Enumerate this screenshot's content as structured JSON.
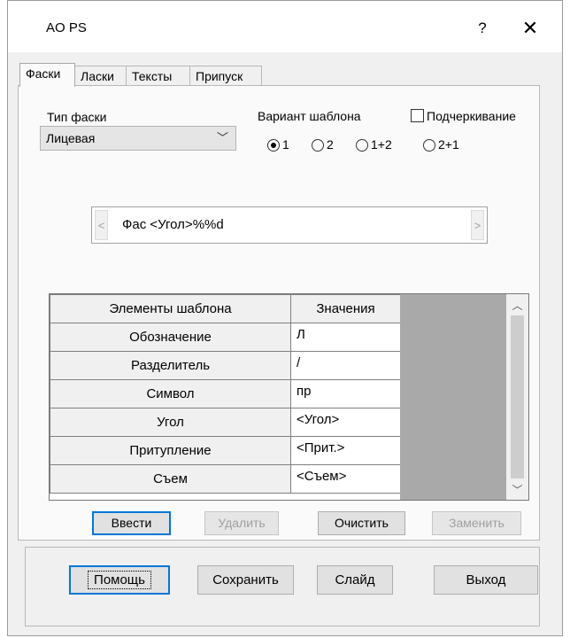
{
  "window": {
    "title": "AO PS",
    "help_label": "?",
    "close_label": "✕"
  },
  "tabs": [
    {
      "label": "Фаски",
      "active": true
    },
    {
      "label": "Ласки",
      "active": false
    },
    {
      "label": "Тексты",
      "active": false
    },
    {
      "label": "Припуск",
      "active": false
    }
  ],
  "bevel_type": {
    "label": "Тип фаски",
    "selected": "Лицевая"
  },
  "template_variant": {
    "label": "Вариант шаблона",
    "options": [
      {
        "label": "1",
        "checked": true
      },
      {
        "label": "2",
        "checked": false
      },
      {
        "label": "1+2",
        "checked": false
      },
      {
        "label": "2+1",
        "checked": false
      }
    ]
  },
  "underline": {
    "label": "Подчеркивание",
    "checked": false
  },
  "template_field": {
    "value": "Фас <Угол>%%d",
    "left_arrow": "<",
    "right_arrow": ">"
  },
  "grid": {
    "headers": [
      "Элементы шаблона",
      "Значения"
    ],
    "rows": [
      {
        "element": "Обозначение",
        "value": "Л"
      },
      {
        "element": "Разделитель",
        "value": "/"
      },
      {
        "element": "Символ",
        "value": "пр"
      },
      {
        "element": "Угол",
        "value": "<Угол>"
      },
      {
        "element": "Притупление",
        "value": "<Прит.>"
      },
      {
        "element": "Съем",
        "value": "<Съем>"
      }
    ]
  },
  "actions": {
    "enter": "Ввести",
    "delete": "Удалить",
    "clear": "Очистить",
    "replace": "Заменить"
  },
  "footer": {
    "help": "Помощь",
    "save": "Сохранить",
    "slide": "Слайд",
    "exit": "Выход"
  }
}
